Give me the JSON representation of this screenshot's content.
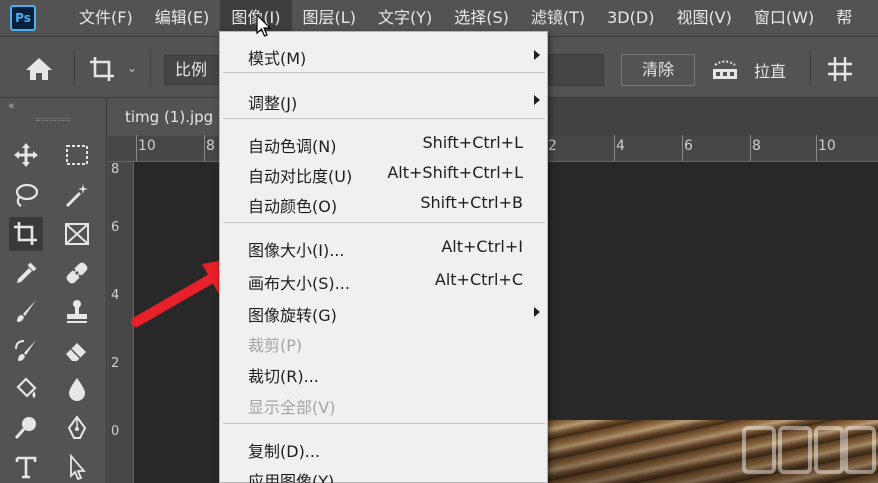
{
  "app": {
    "logo_text": "Ps"
  },
  "menubar": {
    "items": [
      {
        "label": "文件(F)"
      },
      {
        "label": "编辑(E)"
      },
      {
        "label": "图像(I)",
        "active": true
      },
      {
        "label": "图层(L)"
      },
      {
        "label": "文字(Y)"
      },
      {
        "label": "选择(S)"
      },
      {
        "label": "滤镜(T)"
      },
      {
        "label": "3D(D)"
      },
      {
        "label": "视图(V)"
      },
      {
        "label": "窗口(W)"
      },
      {
        "label": "帮"
      }
    ]
  },
  "options_bar": {
    "ratio_label": "比例",
    "clear_label": "清除",
    "straighten_label": "拉直"
  },
  "toolbox": {
    "collapse_glyph": "«"
  },
  "document": {
    "tab_title": "timg (1).jpg",
    "ruler_top_labels": [
      "10",
      "8",
      "2",
      "4",
      "6",
      "8",
      "10"
    ],
    "ruler_left_labels": [
      "8",
      "6",
      "4",
      "2",
      "0"
    ]
  },
  "image_menu": {
    "items": [
      {
        "label": "模式(M)",
        "shortcut": "",
        "submenu": true,
        "enabled": true
      },
      {
        "label": "调整(J)",
        "shortcut": "",
        "submenu": true,
        "enabled": true
      },
      {
        "label": "自动色调(N)",
        "shortcut": "Shift+Ctrl+L",
        "submenu": false,
        "enabled": true
      },
      {
        "label": "自动对比度(U)",
        "shortcut": "Alt+Shift+Ctrl+L",
        "submenu": false,
        "enabled": true
      },
      {
        "label": "自动颜色(O)",
        "shortcut": "Shift+Ctrl+B",
        "submenu": false,
        "enabled": true
      },
      {
        "label": "图像大小(I)...",
        "shortcut": "Alt+Ctrl+I",
        "submenu": false,
        "enabled": true
      },
      {
        "label": "画布大小(S)...",
        "shortcut": "Alt+Ctrl+C",
        "submenu": false,
        "enabled": true
      },
      {
        "label": "图像旋转(G)",
        "shortcut": "",
        "submenu": true,
        "enabled": true
      },
      {
        "label": "裁剪(P)",
        "shortcut": "",
        "submenu": false,
        "enabled": false
      },
      {
        "label": "裁切(R)...",
        "shortcut": "",
        "submenu": false,
        "enabled": true
      },
      {
        "label": "显示全部(V)",
        "shortcut": "",
        "submenu": false,
        "enabled": false
      },
      {
        "label": "复制(D)...",
        "shortcut": "",
        "submenu": false,
        "enabled": true
      },
      {
        "label": "应用图像(Y)...",
        "shortcut": "",
        "submenu": false,
        "enabled": true
      }
    ]
  },
  "colors": {
    "annotation_arrow": "#e8202a",
    "menu_bg": "#f0f0f0",
    "ui_bg": "#535353",
    "canvas_bg": "#282828",
    "ps_blue": "#4ab0f0"
  }
}
